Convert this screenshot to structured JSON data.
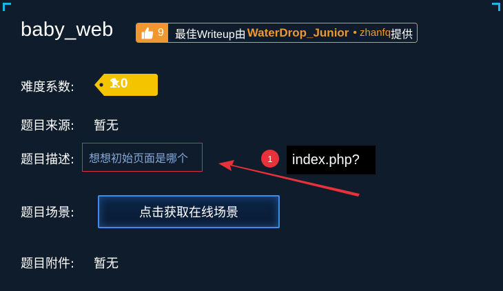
{
  "challenge": {
    "title": "baby_web",
    "likes": "9",
    "writeup_prefix": "最佳Writeup由",
    "writeup_author": "WaterDrop_Junior",
    "writeup_dot": "•",
    "writeup_user": "zhanfq",
    "writeup_suffix": "提供"
  },
  "difficulty": {
    "label": "难度系数:",
    "value": "1.0"
  },
  "source": {
    "label": "题目来源:",
    "value": "暂无"
  },
  "description": {
    "label": "题目描述:",
    "value": "想想初始页面是哪个"
  },
  "scene": {
    "label": "题目场景:",
    "button_label": "点击获取在线场景"
  },
  "attachment": {
    "label": "题目附件:",
    "value": "暂无"
  },
  "annotation": {
    "number": "1",
    "text": "index.php?"
  },
  "colors": {
    "background": "#0f1c2b",
    "accent_orange": "#f09732",
    "badge_yellow": "#f5c400",
    "annotation_red": "#e8313b",
    "link_blue": "#86a8d8",
    "button_border": "#3e8de8"
  },
  "icons": [
    "thumbs-up-icon",
    "star-icon"
  ]
}
